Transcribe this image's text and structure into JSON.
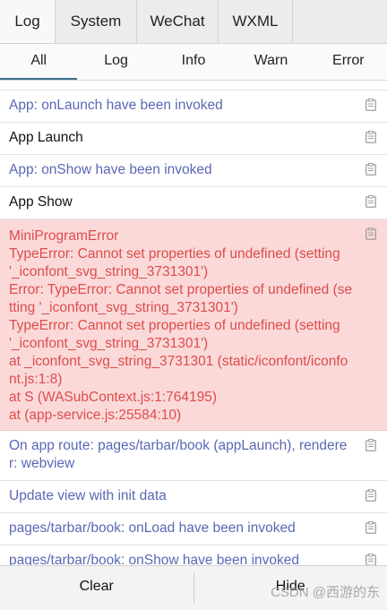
{
  "top_tabs": [
    "Log",
    "System",
    "WeChat",
    "WXML"
  ],
  "sub_tabs": [
    "All",
    "Log",
    "Info",
    "Warn",
    "Error"
  ],
  "logs": [
    {
      "text": "App: onLaunch have been invoked"
    },
    {
      "text": "App Launch"
    },
    {
      "text": "App: onShow have been invoked"
    },
    {
      "text": "App Show"
    },
    {
      "lines": [
        "MiniProgramError",
        "TypeError: Cannot set properties of undefined (setting '_iconfont_svg_string_3731301')",
        "Error: TypeError: Cannot set properties of undefined (setting '_iconfont_svg_string_3731301')",
        "TypeError: Cannot set properties of undefined (setting '_iconfont_svg_string_3731301')",
        "at _iconfont_svg_string_3731301 (static/iconfont/iconfont.js:1:8)",
        "at S (WASubContext.js:1:764195)",
        "at (app-service.js:25584:10)"
      ]
    },
    {
      "text": "On app route: pages/tarbar/book (appLaunch), renderer: webview"
    },
    {
      "text": "Update view with init data"
    },
    {
      "text": "pages/tarbar/book: onLoad have been invoked"
    },
    {
      "text": "pages/tarbar/book: onShow have been invoked"
    }
  ],
  "bottom": {
    "clear": "Clear",
    "hide": "Hide"
  },
  "watermark": "CSDN @西游的东"
}
